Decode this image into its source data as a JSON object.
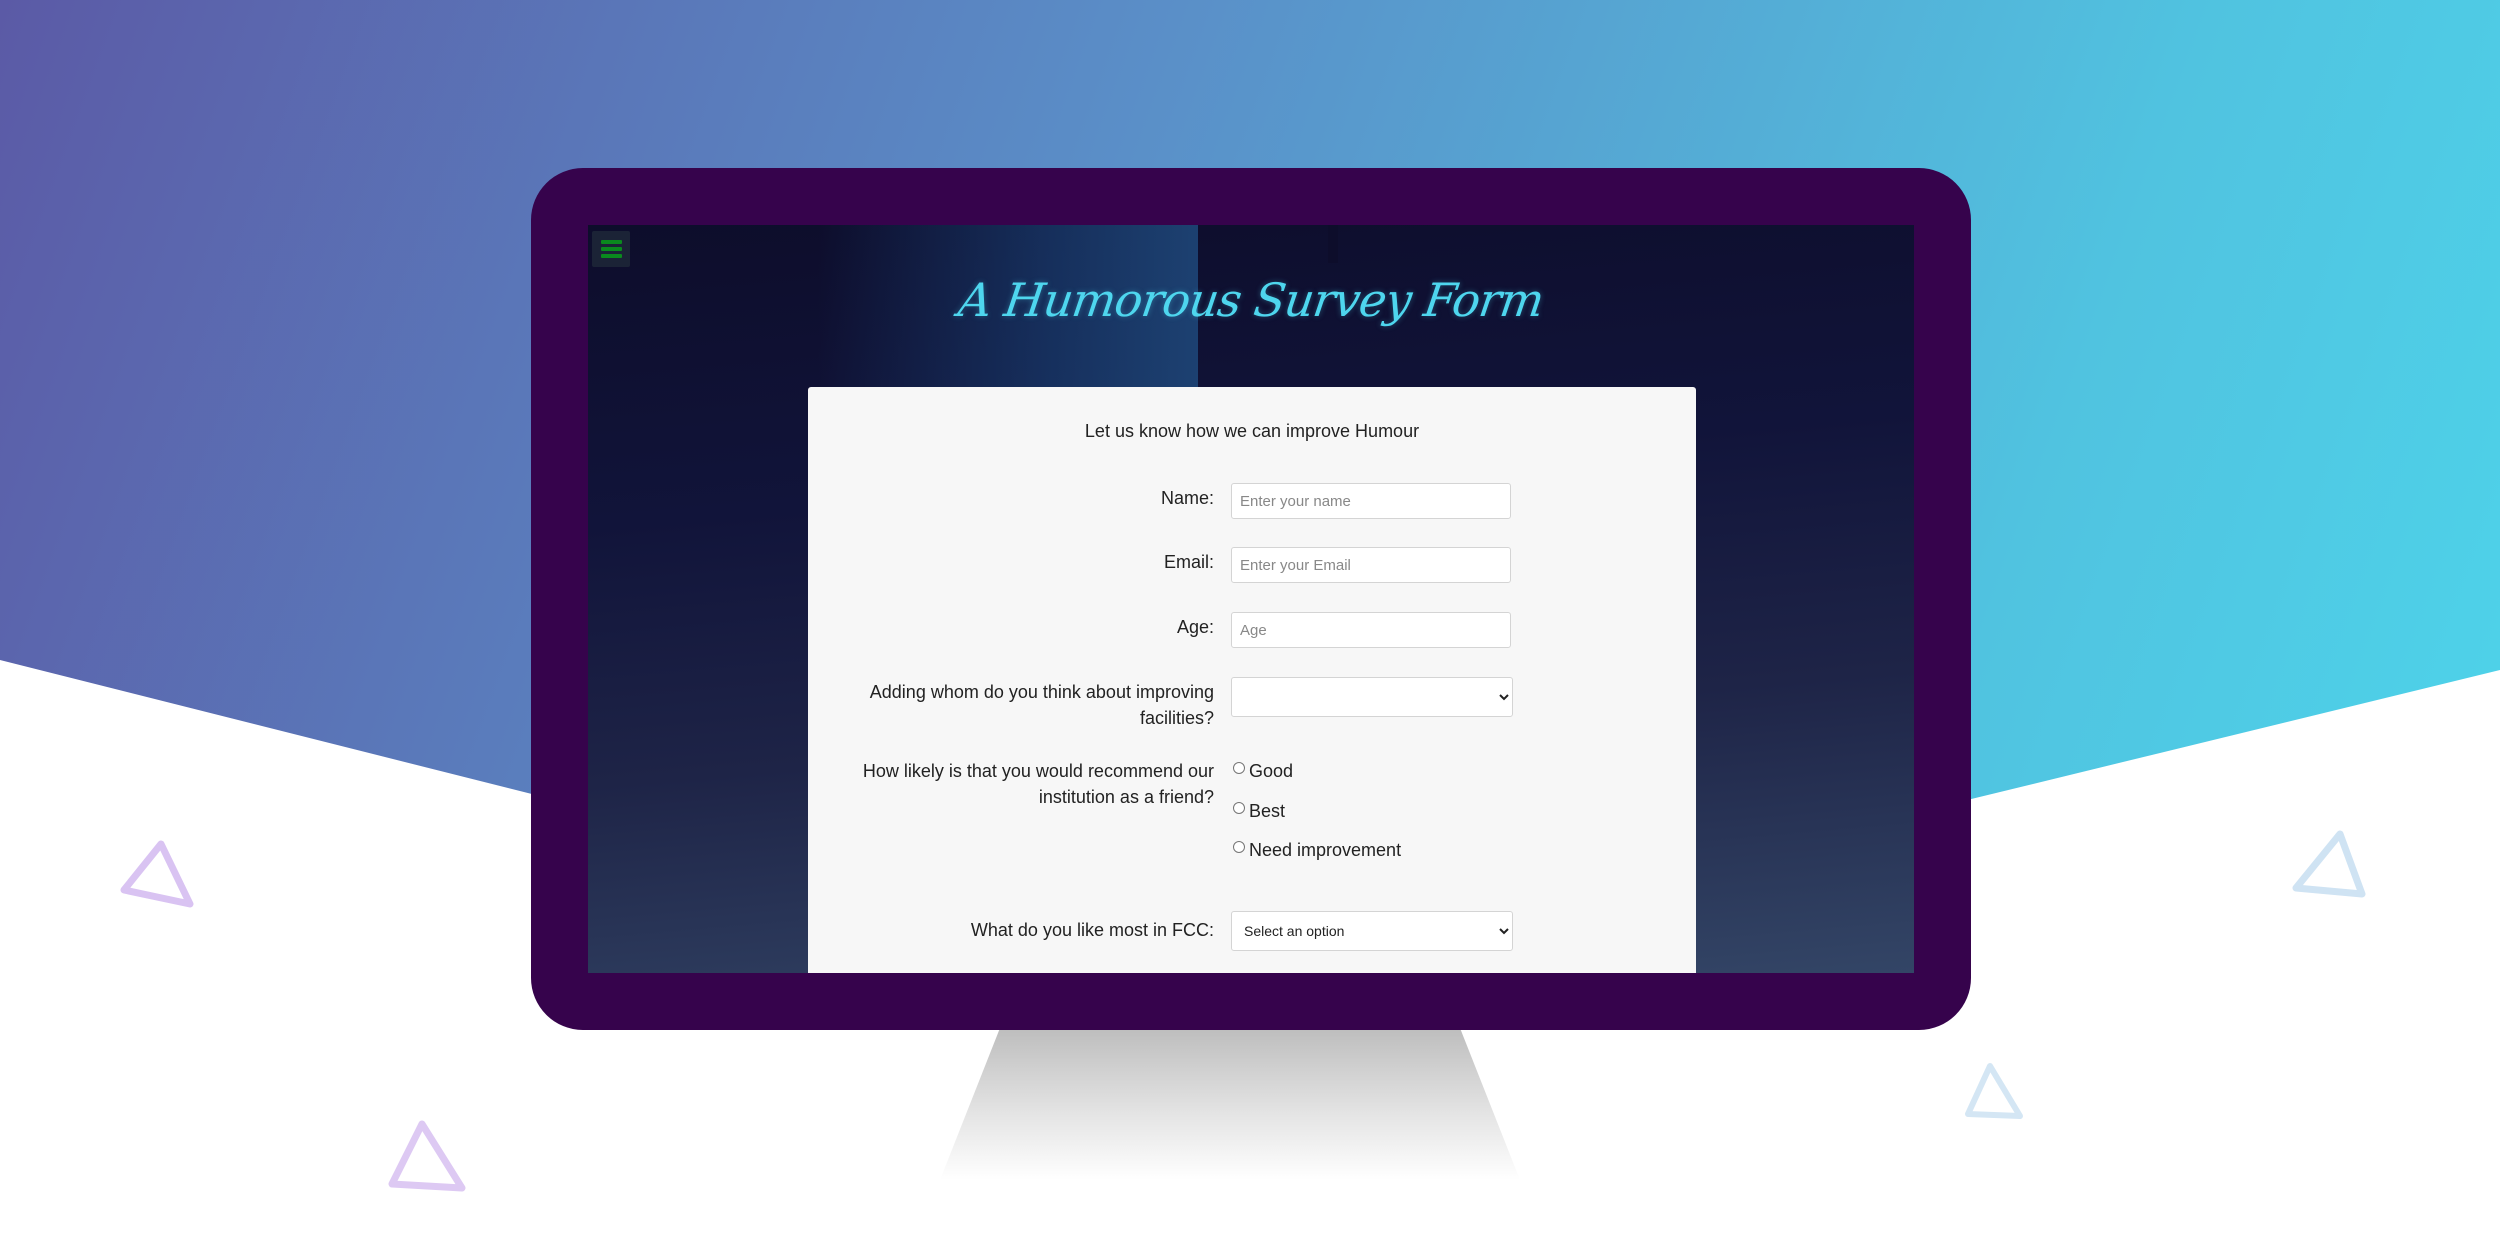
{
  "page": {
    "title": "A Humorous Survey Form"
  },
  "form": {
    "heading": "Let us know how we can improve Humour",
    "name": {
      "label": "Name:",
      "placeholder": "Enter your name",
      "value": ""
    },
    "email": {
      "label": "Email:",
      "placeholder": "Enter your Email",
      "value": ""
    },
    "age": {
      "label": "Age:",
      "placeholder": "Age",
      "value": ""
    },
    "improve": {
      "label_line1": "Adding whom do you think about improving",
      "label_line2": "facilities?",
      "selected": ""
    },
    "recommend": {
      "label_line1": "How likely is that you would recommend our",
      "label_line2": "institution as a friend?",
      "options": [
        "Good",
        "Best",
        "Need improvement"
      ]
    },
    "like_most": {
      "label": "What do you like most in FCC:",
      "selected": "Select an option"
    }
  },
  "colors": {
    "accent": "#4ed6ee",
    "monitor_frame": "#36034c",
    "menu_icon": "#0a8a1e"
  },
  "icons": {
    "menu": "hamburger-icon",
    "decorations": [
      "triangle-outline"
    ]
  }
}
